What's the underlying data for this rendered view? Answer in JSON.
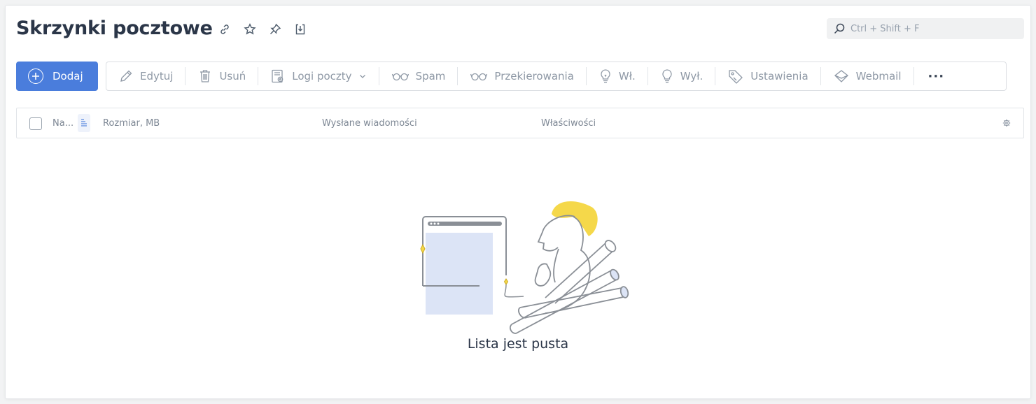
{
  "header": {
    "title": "Skrzynki pocztowe",
    "icons": [
      "link-icon",
      "star-icon",
      "pin-icon",
      "download-icon"
    ],
    "search": {
      "placeholder": "Ctrl + Shift + F",
      "value": ""
    }
  },
  "toolbar": {
    "add_label": "Dodaj",
    "edit_label": "Edytuj",
    "delete_label": "Usuń",
    "logs_label": "Logi poczty",
    "spam_label": "Spam",
    "redirects_label": "Przekierowania",
    "enable_label": "Wł.",
    "disable_label": "Wył.",
    "settings_label": "Ustawienia",
    "webmail_label": "Webmail",
    "more_label": "···"
  },
  "table": {
    "columns": {
      "name": "Na...",
      "size": "Rozmiar, MB",
      "sent": "Wysłane wiadomości",
      "properties": "Właściwości"
    }
  },
  "empty_state": {
    "message": "Lista jest pusta"
  },
  "colors": {
    "accent": "#4a7ddc",
    "illustration_yellow": "#f5d84a",
    "illustration_blue": "#dce4f6"
  }
}
